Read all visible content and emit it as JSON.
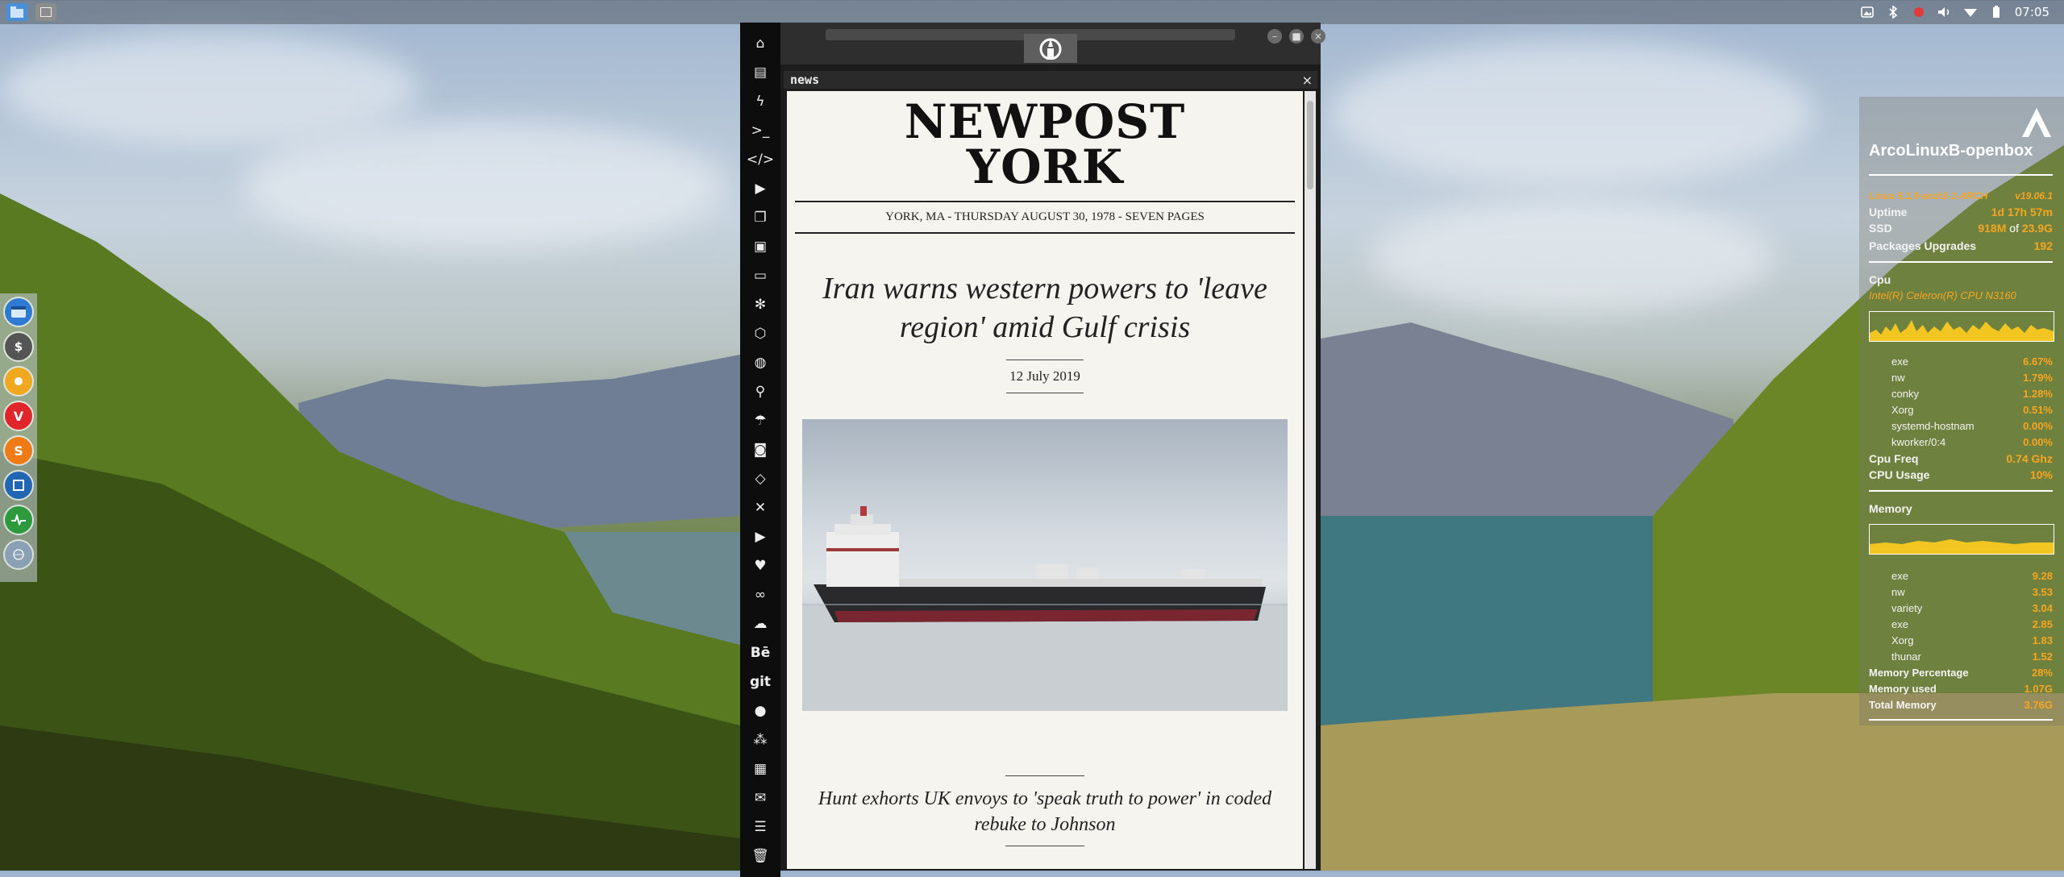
{
  "top_panel": {
    "clock": "07:05",
    "tray": [
      "image-icon",
      "bluetooth-icon",
      "record-icon",
      "volume-icon",
      "wifi-icon",
      "battery-icon"
    ]
  },
  "dock": {
    "items": [
      "window-manager-icon",
      "terminal-dollar-icon",
      "settings-sun-icon",
      "vivaldi-icon",
      "sublime-s-icon",
      "frame-icon",
      "system-monitor-icon",
      "network-globe-icon"
    ]
  },
  "browser": {
    "sidebar_icons": [
      "home-icon",
      "document-icon",
      "lightning-icon",
      "terminal-icon",
      "code-icon",
      "play-icon",
      "copy-icon",
      "image-icon",
      "id-card-icon",
      "snowflake-icon",
      "hexagon-icon",
      "globe-icon",
      "search-icon",
      "umbrella-icon",
      "contact-icon",
      "tag-icon",
      "expand-icon",
      "youtube-icon",
      "heart-icon",
      "creative-cloud-icon",
      "cloud-icon",
      "behance-icon",
      "git-icon",
      "github-icon",
      "hubs-icon",
      "map-icon",
      "mail-icon",
      "list-icon",
      "trash-icon"
    ],
    "behance_label": "Bē",
    "git_label": "git",
    "tab": {
      "label": "news",
      "close": "×"
    },
    "window_buttons": {
      "minimize": "–",
      "maximize": "■",
      "close": "×"
    }
  },
  "newspaper": {
    "masthead_line1": "NEWPOST",
    "masthead_line2": "YORK",
    "dateline": "YORK, MA - THURSDAY AUGUST 30, 1978 - SEVEN PAGES",
    "headline": "Iran warns western powers to 'leave region' amid Gulf crisis",
    "article_date": "12 July 2019",
    "subhead": "Hunt exhorts UK envoys to 'speak truth to power' in coded rebuke to Johnson"
  },
  "conky": {
    "hostname": "ArcoLinuxB-openbox",
    "kernel": "Linux 5.1.9-arch1-1-ARCH",
    "version": "v19.06.1",
    "uptime_label": "Uptime",
    "uptime": "1d 17h 57m",
    "ssd_label": "SSD",
    "ssd_used": "918M",
    "ssd_of": "of",
    "ssd_total": "23.9G",
    "packages_label": "Packages Upgrades",
    "packages": "192",
    "cpu_label": "Cpu",
    "cpu_model": "Intel(R) Celeron(R) CPU  N3160",
    "cpu_procs": [
      {
        "name": "exe",
        "value": "6.67%"
      },
      {
        "name": "nw",
        "value": "1.79%"
      },
      {
        "name": "conky",
        "value": "1.28%"
      },
      {
        "name": "Xorg",
        "value": "0.51%"
      },
      {
        "name": "systemd-hostnam",
        "value": "0.00%"
      },
      {
        "name": "kworker/0:4",
        "value": "0.00%"
      }
    ],
    "cpu_freq_label": "Cpu Freq",
    "cpu_freq": "0.74 Ghz",
    "cpu_usage_label": "CPU Usage",
    "cpu_usage": "10%",
    "memory_label": "Memory",
    "mem_procs": [
      {
        "name": "exe",
        "value": "9.28"
      },
      {
        "name": "nw",
        "value": "3.53"
      },
      {
        "name": "variety",
        "value": "3.04"
      },
      {
        "name": "exe",
        "value": "2.85"
      },
      {
        "name": "Xorg",
        "value": "1.83"
      },
      {
        "name": "thunar",
        "value": "1.52"
      }
    ],
    "mem_pct_label": "Memory Percentage",
    "mem_pct": "28%",
    "mem_used_label": "Memory used",
    "mem_used": "1.07G",
    "mem_total_label": "Total Memory",
    "mem_total": "3.76G",
    "colors": {
      "accent": "#f5a623",
      "text": "#ffffff"
    }
  }
}
